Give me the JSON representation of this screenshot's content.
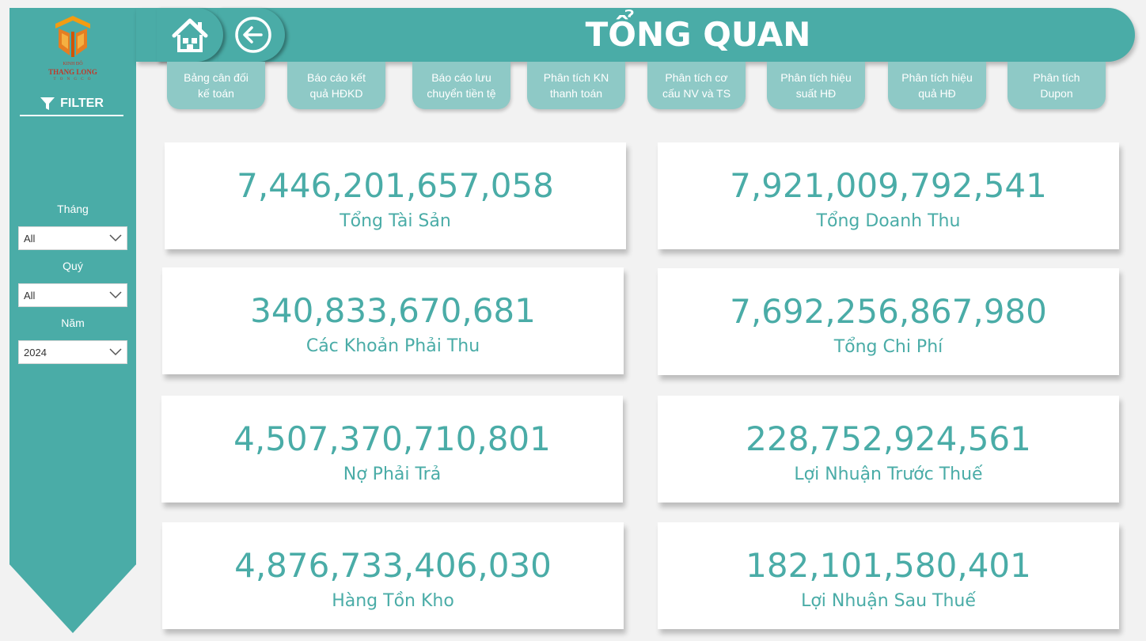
{
  "logo": {
    "line1": "KINH ĐÔ",
    "line2": "THANG LONG",
    "line3": "T O N G C O"
  },
  "sidebar": {
    "filter_label": "FILTER",
    "slicers": [
      {
        "label": "Tháng",
        "value": "All"
      },
      {
        "label": "Quý",
        "value": "All"
      },
      {
        "label": "Năm",
        "value": "2024"
      }
    ]
  },
  "header": {
    "title": "TỔNG QUAN",
    "home_icon": "home-icon",
    "back_icon": "back-arrow-icon"
  },
  "tabs": [
    {
      "label": "Bảng cân đối\nkế toán"
    },
    {
      "label": "Báo cáo kết\nquả HĐKD"
    },
    {
      "label": "Báo cáo lưu\nchuyển tiền tệ"
    },
    {
      "label": "Phân tích KN\nthanh toán"
    },
    {
      "label": "Phân tích cơ\ncấu NV và TS"
    },
    {
      "label": "Phân tích hiệu\nsuất HĐ"
    },
    {
      "label": "Phân tích hiệu\nquả HĐ"
    },
    {
      "label": "Phân tích\nDupon"
    }
  ],
  "kpis": [
    {
      "value": "7,446,201,657,058",
      "label": "Tổng Tài Sản"
    },
    {
      "value": "7,921,009,792,541",
      "label": "Tổng Doanh Thu"
    },
    {
      "value": "340,833,670,681",
      "label": "Các Khoản Phải Thu"
    },
    {
      "value": "7,692,256,867,980",
      "label": "Tổng Chi Phí"
    },
    {
      "value": "4,507,370,710,801",
      "label": "Nợ Phải Trả"
    },
    {
      "value": "228,752,924,561",
      "label": "Lợi Nhuận Trước Thuế"
    },
    {
      "value": "4,876,733,406,030",
      "label": "Hàng Tồn Kho"
    },
    {
      "value": "182,101,580,401",
      "label": "Lợi Nhuận Sau Thuế"
    }
  ],
  "colors": {
    "accent": "#4aaca7",
    "tab": "#8ec9c6",
    "background": "#f2f2f2",
    "logo": "#e67e22"
  }
}
